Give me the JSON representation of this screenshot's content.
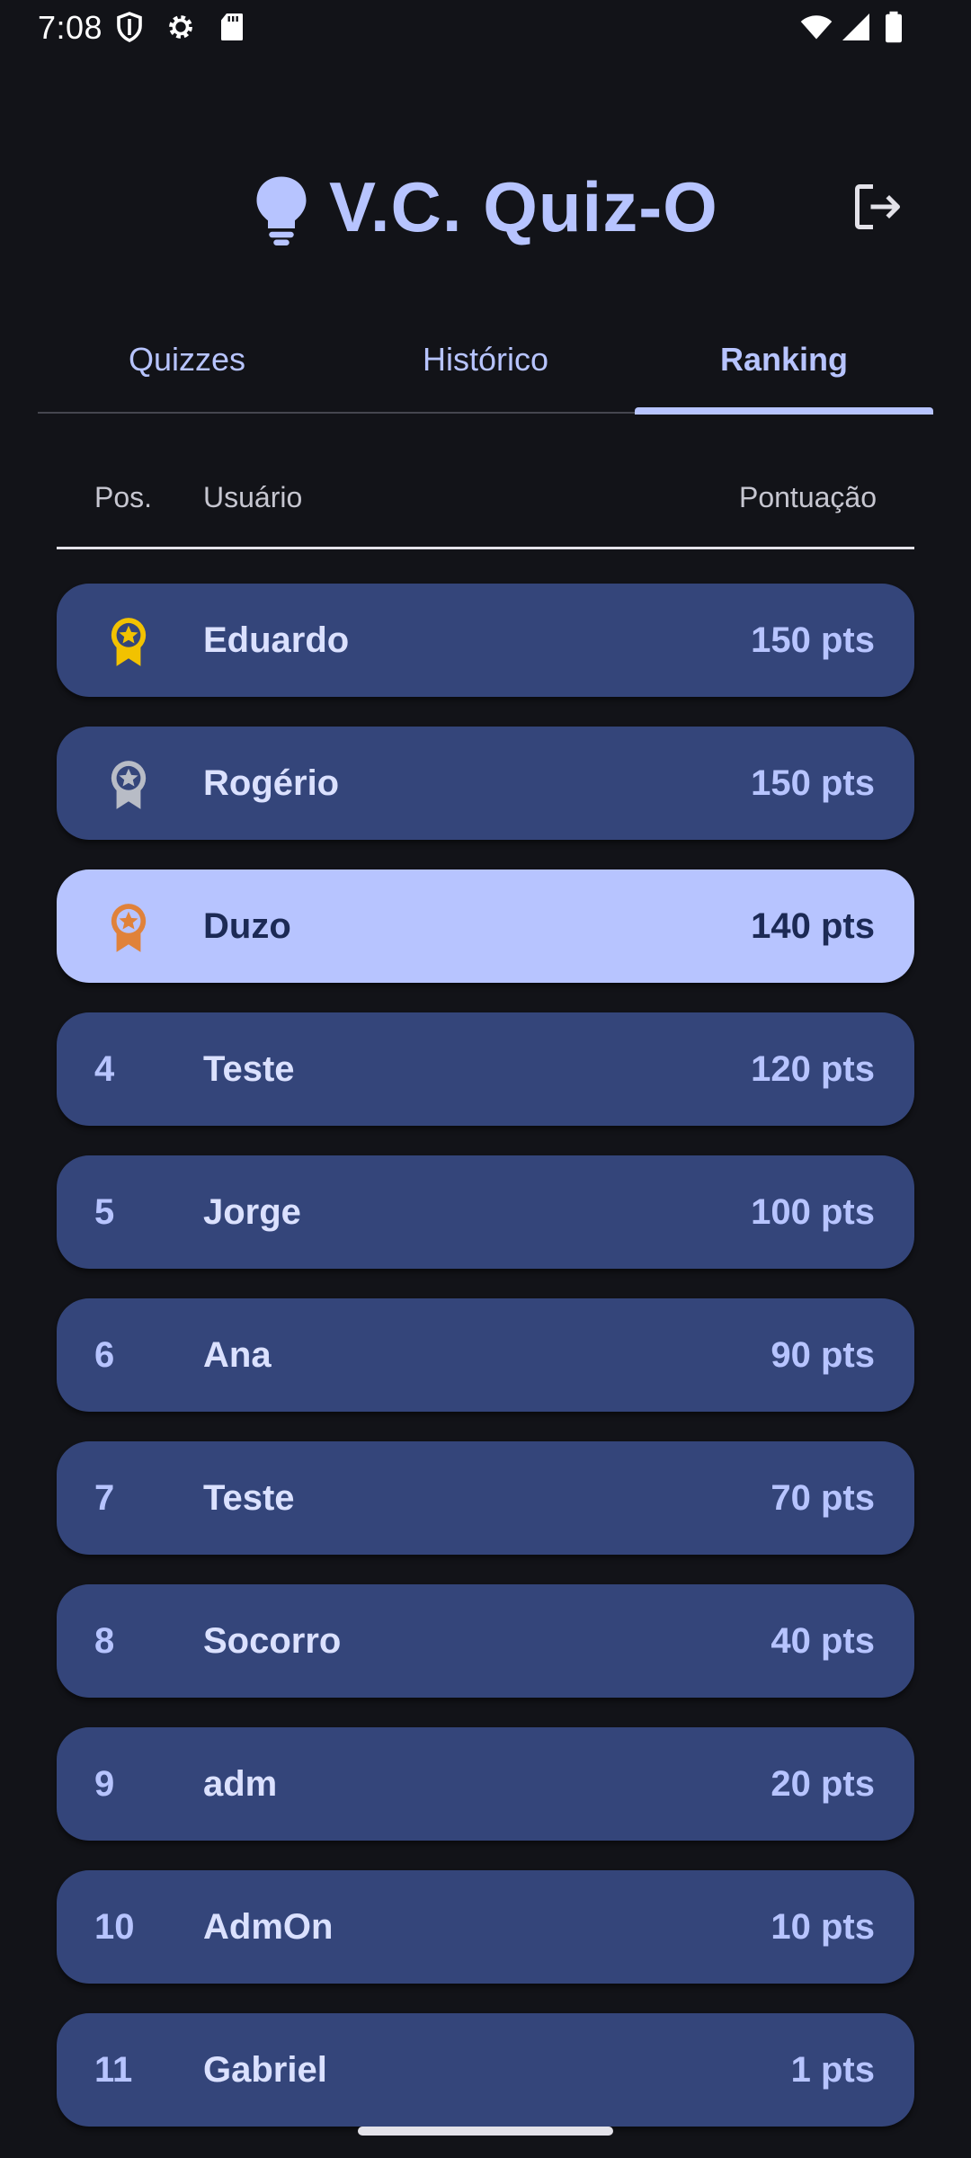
{
  "status_bar": {
    "time": "7:08",
    "left_icons": [
      "shield-icon",
      "gear-icon",
      "sd-card-icon"
    ],
    "right_icons": [
      "wifi-icon",
      "signal-icon",
      "battery-icon"
    ]
  },
  "header": {
    "title": "V.C. Quiz-O",
    "logo_icon": "lightbulb-icon",
    "logout_icon": "logout-icon"
  },
  "tabs": [
    {
      "label": "Quizzes",
      "active": false
    },
    {
      "label": "Histórico",
      "active": false
    },
    {
      "label": "Ranking",
      "active": true
    }
  ],
  "table": {
    "columns": {
      "pos": "Pos.",
      "user": "Usuário",
      "score": "Pontuação"
    },
    "rows": [
      {
        "pos": "",
        "medal": "gold",
        "name": "Eduardo",
        "score": "150 pts"
      },
      {
        "pos": "",
        "medal": "silver",
        "name": "Rogério",
        "score": "150 pts"
      },
      {
        "pos": "",
        "medal": "bronze",
        "name": "Duzo",
        "score": "140 pts",
        "highlight": true
      },
      {
        "pos": "4",
        "name": "Teste",
        "score": "120 pts"
      },
      {
        "pos": "5",
        "name": "Jorge",
        "score": "100 pts"
      },
      {
        "pos": "6",
        "name": "Ana",
        "score": "90 pts"
      },
      {
        "pos": "7",
        "name": "Teste",
        "score": "70 pts"
      },
      {
        "pos": "8",
        "name": "Socorro",
        "score": "40 pts"
      },
      {
        "pos": "9",
        "name": "adm",
        "score": "20 pts"
      },
      {
        "pos": "10",
        "name": "AdmOn",
        "score": "10 pts"
      },
      {
        "pos": "11",
        "name": "Gabriel",
        "score": "1 pts"
      }
    ]
  },
  "colors": {
    "background": "#121318",
    "accent": "#b7c4ff",
    "row": "#34457a",
    "row_highlight": "#b7c4ff",
    "gold": "#f2c200",
    "silver": "#b8bcc6",
    "bronze": "#e0823a"
  }
}
